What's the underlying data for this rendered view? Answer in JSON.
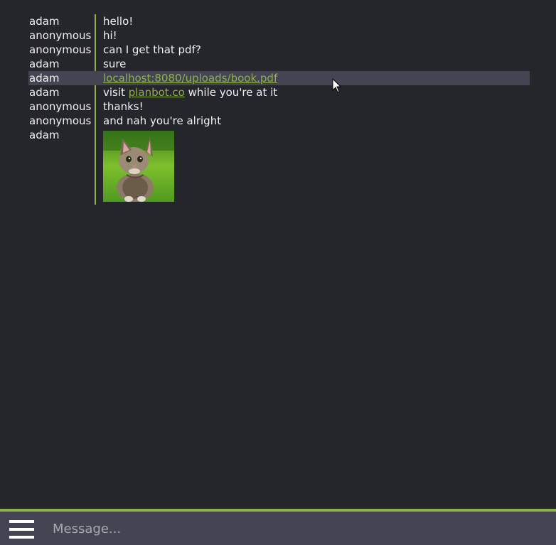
{
  "messages": [
    {
      "user": "adam",
      "text": "hello!"
    },
    {
      "user": "anonymous",
      "text": "hi!"
    },
    {
      "user": "anonymous",
      "text": "can I get that pdf?"
    },
    {
      "user": "adam",
      "text": "sure"
    },
    {
      "user": "adam",
      "link_text": "localhost:8080/uploads/book.pdf",
      "highlighted": true
    },
    {
      "user": "adam",
      "text_before": "visit ",
      "link_text": "planbot.co",
      "text_after": " while you're at it"
    },
    {
      "user": "anonymous",
      "text": "thanks!"
    },
    {
      "user": "anonymous",
      "text": "and nah you're alright"
    },
    {
      "user": "adam",
      "image": "kitten-photo"
    }
  ],
  "composer": {
    "placeholder": "Message...",
    "value": "",
    "menu_icon": "hamburger-menu-icon"
  },
  "colors": {
    "background": "#25262b",
    "accent": "#8fb14b",
    "highlight": "#454452",
    "composer_bg": "#454452",
    "text": "#f0f0f0"
  }
}
